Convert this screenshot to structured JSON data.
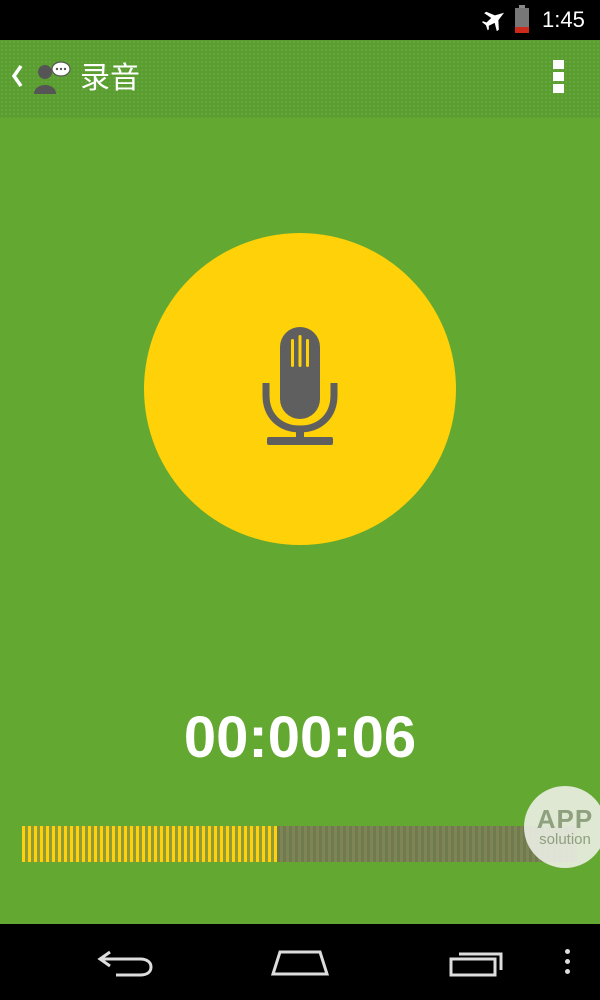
{
  "status_bar": {
    "time": "1:45",
    "icons": [
      "airplane-mode-icon",
      "battery-icon"
    ]
  },
  "app_bar": {
    "title": "录音",
    "icons": [
      "back-chevron-icon",
      "app-logo-icon",
      "overflow-menu-icon"
    ]
  },
  "recorder": {
    "button_icon": "microphone-icon",
    "elapsed": "00:00:06",
    "level_fraction": 0.46
  },
  "watermark": {
    "top": "APP",
    "bottom": "solution"
  },
  "nav_bar": {
    "icons": [
      "back-icon",
      "home-icon",
      "recents-icon",
      "menu-icon"
    ]
  },
  "colors": {
    "background": "#63a831",
    "app_bar": "#5a9e30",
    "accent": "#fed108",
    "icon_gray": "#5f5f5f"
  }
}
